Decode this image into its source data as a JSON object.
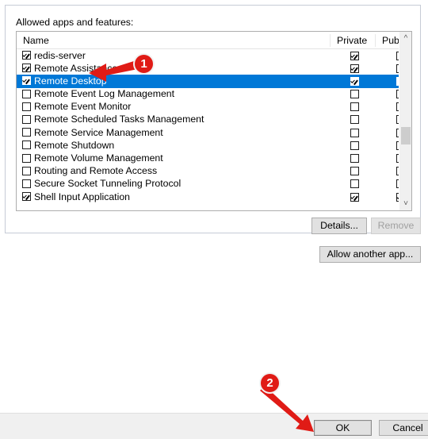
{
  "dialog": {
    "group_label": "Allowed apps and features:"
  },
  "list": {
    "columns": {
      "name": "Name",
      "private": "Private",
      "public": "Public",
      "sort_indicator_icon": "chevron-up-icon"
    },
    "rows": [
      {
        "name": "redis-server",
        "enabled": true,
        "private": true,
        "public": false,
        "selected": false
      },
      {
        "name": "Remote Assistance",
        "enabled": true,
        "private": true,
        "public": false,
        "selected": false
      },
      {
        "name": "Remote Desktop",
        "enabled": true,
        "private": true,
        "public": false,
        "selected": true
      },
      {
        "name": "Remote Event Log Management",
        "enabled": false,
        "private": false,
        "public": false,
        "selected": false
      },
      {
        "name": "Remote Event Monitor",
        "enabled": false,
        "private": false,
        "public": false,
        "selected": false
      },
      {
        "name": "Remote Scheduled Tasks Management",
        "enabled": false,
        "private": false,
        "public": false,
        "selected": false
      },
      {
        "name": "Remote Service Management",
        "enabled": false,
        "private": false,
        "public": false,
        "selected": false
      },
      {
        "name": "Remote Shutdown",
        "enabled": false,
        "private": false,
        "public": false,
        "selected": false
      },
      {
        "name": "Remote Volume Management",
        "enabled": false,
        "private": false,
        "public": false,
        "selected": false
      },
      {
        "name": "Routing and Remote Access",
        "enabled": false,
        "private": false,
        "public": false,
        "selected": false
      },
      {
        "name": "Secure Socket Tunneling Protocol",
        "enabled": false,
        "private": false,
        "public": false,
        "selected": false
      },
      {
        "name": "Shell Input Application",
        "enabled": true,
        "private": true,
        "public": true,
        "selected": false
      }
    ],
    "scrollbar": {
      "up_arrow_icon": "chevron-up-icon",
      "down_arrow_icon": "chevron-down-icon"
    }
  },
  "buttons": {
    "details": "Details...",
    "remove": "Remove",
    "allow_another_app": "Allow another app...",
    "ok": "OK",
    "cancel": "Cancel"
  },
  "annotations": [
    {
      "label": "1",
      "color": "#e01b16"
    },
    {
      "label": "2",
      "color": "#e01b16"
    }
  ]
}
